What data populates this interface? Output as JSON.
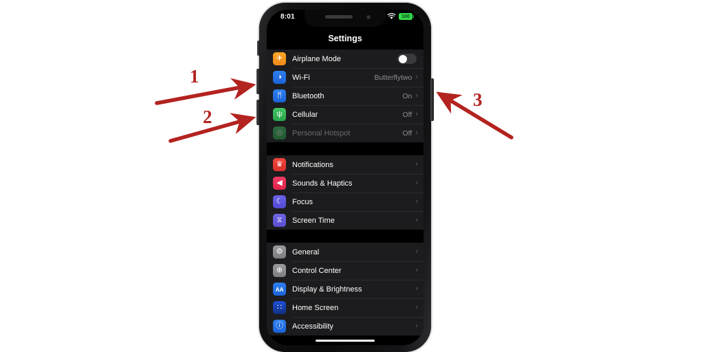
{
  "device": {
    "name": "iPhone",
    "status_bar": {
      "time": "8:01",
      "wifi_icon": "wifi-icon",
      "battery_level": "100",
      "battery_color": "#32d74b"
    },
    "side_controls": [
      {
        "name": "ringer-switch",
        "label": "Ring/Silent switch"
      },
      {
        "name": "volume-up-button",
        "label": "Volume Up"
      },
      {
        "name": "volume-down-button",
        "label": "Volume Down"
      },
      {
        "name": "side-button",
        "label": "Side Button"
      }
    ]
  },
  "nav": {
    "title": "Settings"
  },
  "groups": [
    {
      "id": "connectivity",
      "rows": [
        {
          "label": "Airplane Mode",
          "icon": "airplane-icon",
          "icon_class": "ic-airplane",
          "glyph": "✈",
          "control": "toggle",
          "toggle_on": false,
          "dim": false
        },
        {
          "label": "Wi-Fi",
          "icon": "wifi-icon",
          "icon_class": "ic-wifi",
          "glyph": "◑",
          "value": "Butterflytwo",
          "control": "chevron",
          "dim": false
        },
        {
          "label": "Bluetooth",
          "icon": "bluetooth-icon",
          "icon_class": "ic-bluetooth",
          "glyph": "ᛗ",
          "value": "On",
          "control": "chevron",
          "dim": false
        },
        {
          "label": "Cellular",
          "icon": "cellular-icon",
          "icon_class": "ic-cellular",
          "glyph": "ψ",
          "value": "Off",
          "control": "chevron",
          "dim": false
        },
        {
          "label": "Personal Hotspot",
          "icon": "hotspot-icon",
          "icon_class": "ic-hotspot",
          "glyph": "◎",
          "value": "Off",
          "control": "chevron",
          "dim": true
        }
      ]
    },
    {
      "id": "notifications",
      "rows": [
        {
          "label": "Notifications",
          "icon": "bell-icon",
          "icon_class": "ic-notif",
          "glyph": "♛",
          "control": "chevron",
          "dim": false
        },
        {
          "label": "Sounds & Haptics",
          "icon": "speaker-icon",
          "icon_class": "ic-sounds",
          "glyph": "◀",
          "control": "chevron",
          "dim": false
        },
        {
          "label": "Focus",
          "icon": "moon-icon",
          "icon_class": "ic-focus",
          "glyph": "☾",
          "control": "chevron",
          "dim": false
        },
        {
          "label": "Screen Time",
          "icon": "hourglass-icon",
          "icon_class": "ic-screentime",
          "glyph": "⧖",
          "control": "chevron",
          "dim": false
        }
      ]
    },
    {
      "id": "system",
      "rows": [
        {
          "label": "General",
          "icon": "gear-icon",
          "icon_class": "ic-general",
          "glyph": "⚙",
          "control": "chevron",
          "dim": false
        },
        {
          "label": "Control Center",
          "icon": "control-center-icon",
          "icon_class": "ic-control",
          "glyph": "⊕",
          "control": "chevron",
          "dim": false
        },
        {
          "label": "Display & Brightness",
          "icon": "display-brightness-icon",
          "icon_class": "ic-display",
          "glyph": "AA",
          "glyph_small": true,
          "control": "chevron",
          "dim": false
        },
        {
          "label": "Home Screen",
          "icon": "home-screen-icon",
          "icon_class": "ic-home",
          "glyph": "∷",
          "control": "chevron",
          "dim": false
        },
        {
          "label": "Accessibility",
          "icon": "accessibility-icon",
          "icon_class": "ic-access",
          "glyph": "ⓘ",
          "control": "chevron",
          "dim": false
        }
      ]
    }
  ],
  "annotations": {
    "color": "#b3231f",
    "markers": [
      {
        "id": "1",
        "label": "1",
        "points_to": "volume-up-button"
      },
      {
        "id": "2",
        "label": "2",
        "points_to": "volume-down-button"
      },
      {
        "id": "3",
        "label": "3",
        "points_to": "side-button"
      }
    ]
  }
}
